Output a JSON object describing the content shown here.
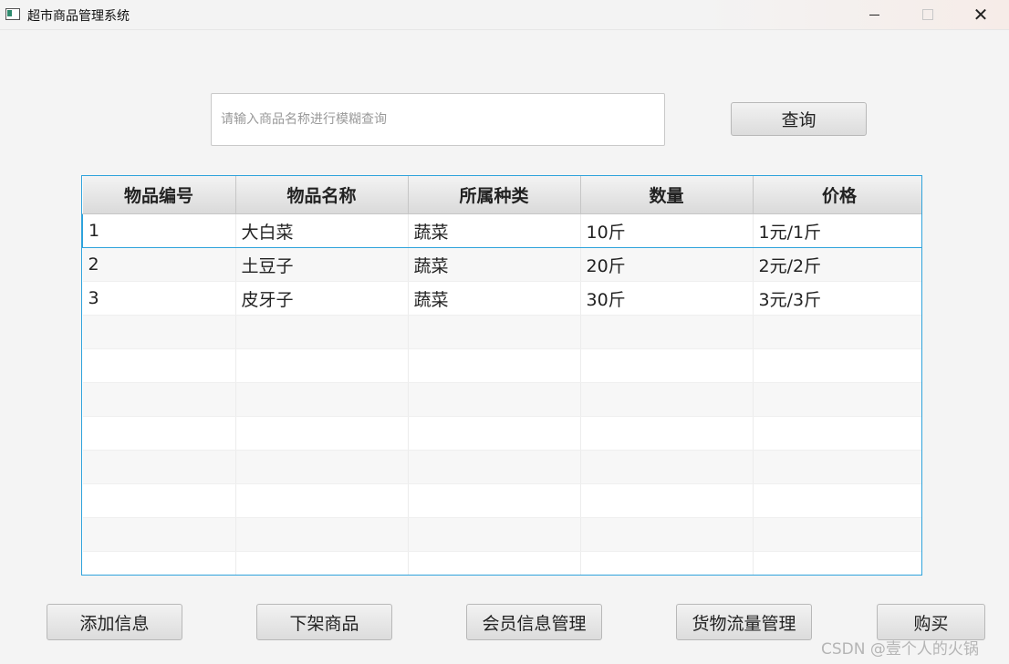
{
  "window": {
    "title": "超市商品管理系统",
    "min_icon": "minimize-icon",
    "max_icon": "maximize-icon",
    "close_icon": "close-icon"
  },
  "search": {
    "placeholder": "请输入商品名称进行模糊查询",
    "value": "",
    "button_label": "查询"
  },
  "table": {
    "columns": [
      "物品编号",
      "物品名称",
      "所属种类",
      "数量",
      "价格"
    ],
    "rows": [
      [
        "1",
        "大白菜",
        "蔬菜",
        "10斤",
        "1元/1斤"
      ],
      [
        "2",
        "土豆子",
        "蔬菜",
        "20斤",
        "2元/2斤"
      ],
      [
        "3",
        "皮牙子",
        "蔬菜",
        "30斤",
        "3元/3斤"
      ]
    ],
    "selected_row": 0,
    "empty_rows": 8
  },
  "actions": {
    "add": "添加信息",
    "remove": "下架商品",
    "members": "会员信息管理",
    "flow": "货物流量管理",
    "buy": "购买"
  },
  "watermark": "CSDN @壹个人的火锅",
  "colors": {
    "accent": "#2fa3dc",
    "background": "#f4f4f4"
  }
}
